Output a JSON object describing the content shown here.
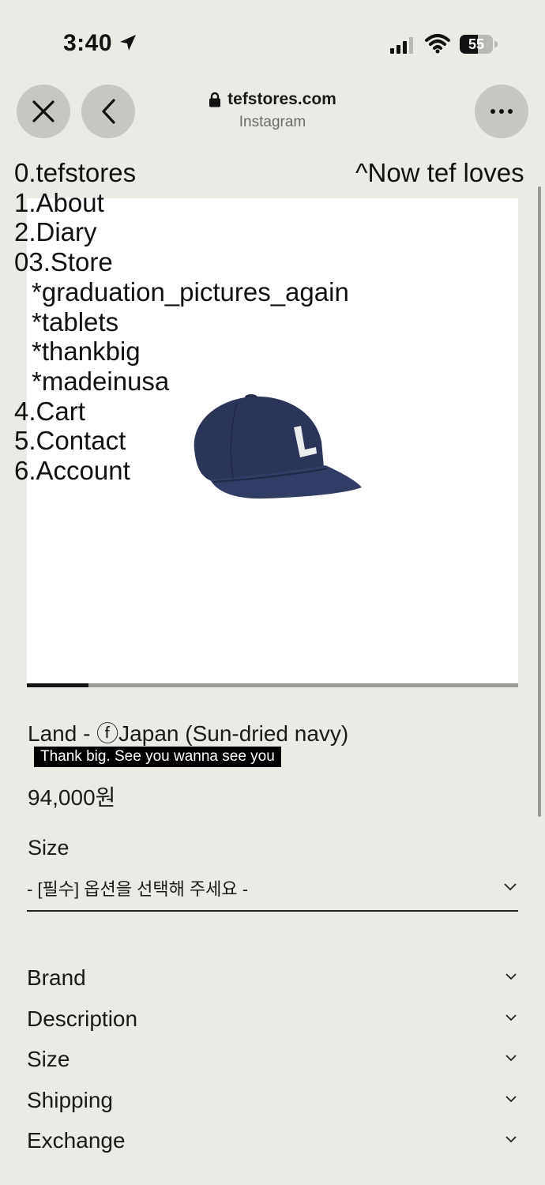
{
  "status_bar": {
    "time": "3:40",
    "battery_percent": "55",
    "battery_level": 0.55,
    "icons": [
      "location-arrow-icon",
      "signal-icon",
      "wifi-icon",
      "battery-icon"
    ]
  },
  "browser": {
    "domain": "tefstores.com",
    "subtitle": "Instagram",
    "buttons": [
      "close-icon",
      "back-icon",
      "more-icon"
    ]
  },
  "menu": {
    "items": [
      {
        "label": "0.tefstores"
      },
      {
        "label": "1.About"
      },
      {
        "label": "2.Diary"
      },
      {
        "label": "03.Store"
      },
      {
        "label": "*graduation_pictures_again",
        "sub": true
      },
      {
        "label": "*tablets",
        "sub": true
      },
      {
        "label": "*thankbig",
        "sub": true
      },
      {
        "label": "*madeinusa",
        "sub": true
      },
      {
        "label": "4.Cart"
      },
      {
        "label": "5.Contact"
      },
      {
        "label": "6.Account"
      }
    ],
    "right_link": "^Now tef loves"
  },
  "product": {
    "image_icon": "baseball-cap-image",
    "image_progress": 0.125,
    "name": "Land - ⓕJapan (Sun-dried navy)",
    "tagline": "Thank big. See you wanna see you",
    "price": "94,000원",
    "size_label": "Size",
    "size_select_value": "- [필수] 옵션을 선택해 주세요 -",
    "accordion": [
      "Brand",
      "Description",
      "Size",
      "Shipping",
      "Exchange"
    ]
  },
  "colors": {
    "background": "#eceae4",
    "cap_navy": "#2a3558",
    "button_gray": "#c7c6c1"
  }
}
